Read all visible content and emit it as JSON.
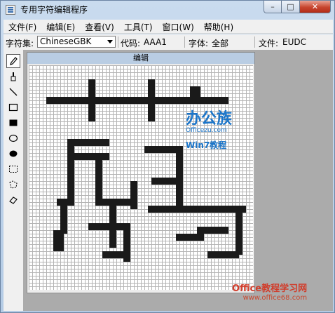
{
  "window": {
    "title": "专用字符编辑程序",
    "caption_buttons": {
      "minimize": "–",
      "maximize": "□",
      "close": "✕"
    }
  },
  "menu": [
    "文件(F)",
    "编辑(E)",
    "查看(V)",
    "工具(T)",
    "窗口(W)",
    "帮助(H)"
  ],
  "infobar": {
    "charset_label": "字符集:",
    "charset_value": "ChineseGBK",
    "code_label": "代码:",
    "code_value": "AAA1",
    "font_label": "字体:",
    "font_value": "全部",
    "file_label": "文件:",
    "file_value": "EUDC"
  },
  "toolbox": [
    "pencil-icon",
    "brush-icon",
    "line-icon",
    "hollow-rectangle-icon",
    "filled-rectangle-icon",
    "hollow-ellipse-icon",
    "filled-ellipse-icon",
    "rectangular-select-icon",
    "freeform-select-icon",
    "eraser-icon"
  ],
  "editor": {
    "title": "编辑",
    "grid_cells": 64,
    "glyph_color": "#1a1a1a"
  },
  "watermarks": {
    "logo_text": "办公族",
    "logo_sub": "Officezu.com",
    "logo_sub2": "Win7教程",
    "footer_text": "Office教程学习网",
    "footer_url": "www.office68.com"
  }
}
